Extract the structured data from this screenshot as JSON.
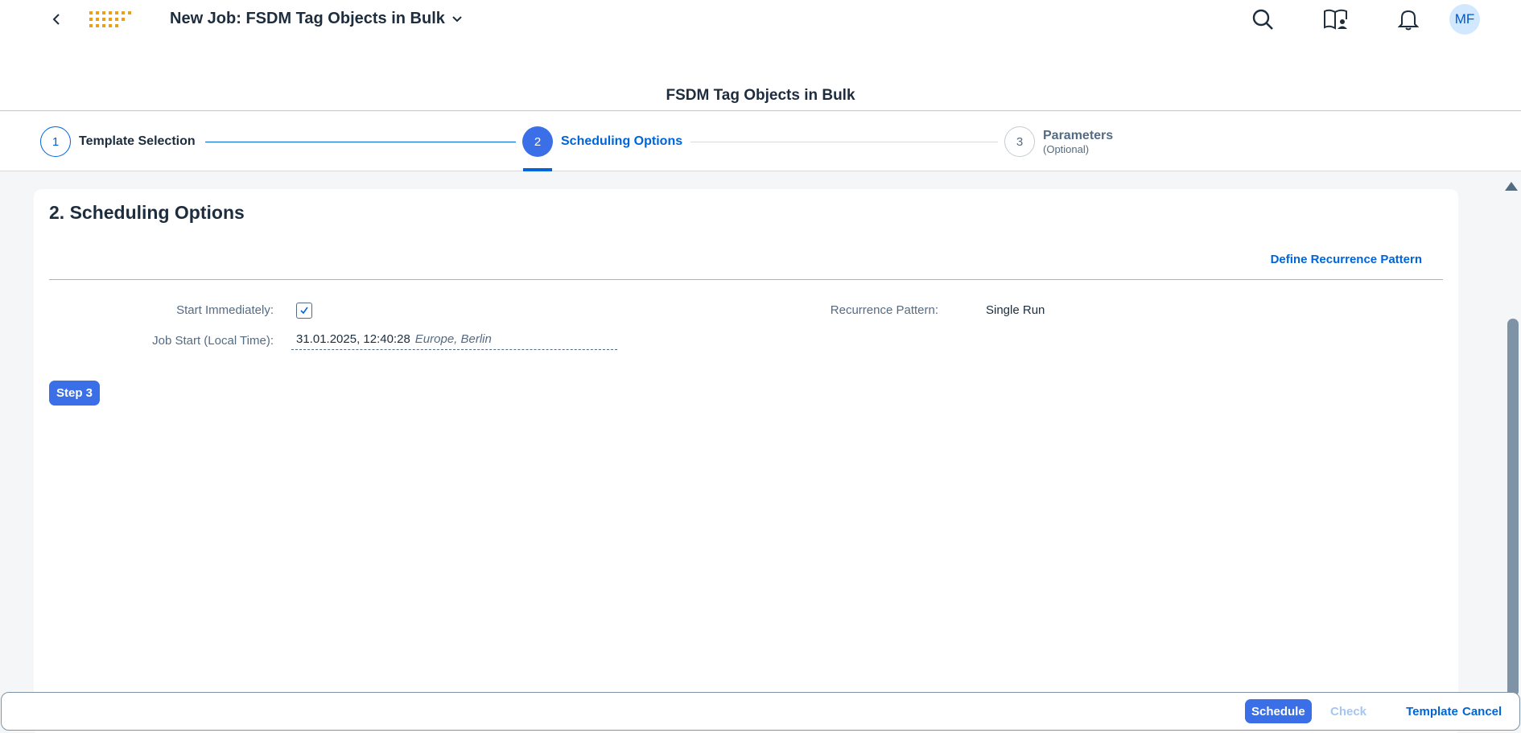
{
  "shell": {
    "title": "New Job: FSDM Tag Objects in Bulk",
    "avatar_initials": "MF",
    "icons": [
      "back-icon",
      "app-launcher-logo",
      "chevron-down-icon",
      "search-icon",
      "help-book-icon",
      "bell-icon"
    ]
  },
  "page": {
    "title": "FSDM Tag Objects in Bulk"
  },
  "wizard": {
    "steps": [
      {
        "number": "1",
        "label": "Template Selection",
        "sublabel": "",
        "state": "completed"
      },
      {
        "number": "2",
        "label": "Scheduling Options",
        "sublabel": "",
        "state": "active"
      },
      {
        "number": "3",
        "label": "Parameters",
        "sublabel": "(Optional)",
        "state": "future"
      }
    ]
  },
  "section": {
    "title": "2. Scheduling Options",
    "define_recurrence_link": "Define Recurrence Pattern",
    "start_immediately_label": "Start Immediately:",
    "start_immediately_checked": true,
    "job_start_label": "Job Start (Local Time):",
    "job_start_value": "31.01.2025, 12:40:28",
    "job_start_timezone": "Europe, Berlin",
    "recurrence_label": "Recurrence Pattern:",
    "recurrence_value": "Single Run",
    "step3_button": "Step 3"
  },
  "footer": {
    "schedule": "Schedule",
    "check": "Check",
    "template": "Template",
    "cancel": "Cancel"
  },
  "colors": {
    "accent": "#0064d9",
    "primary_button": "#3a6fe8",
    "avatar_bg": "#d1e8ff",
    "background": "#f5f6f7"
  }
}
